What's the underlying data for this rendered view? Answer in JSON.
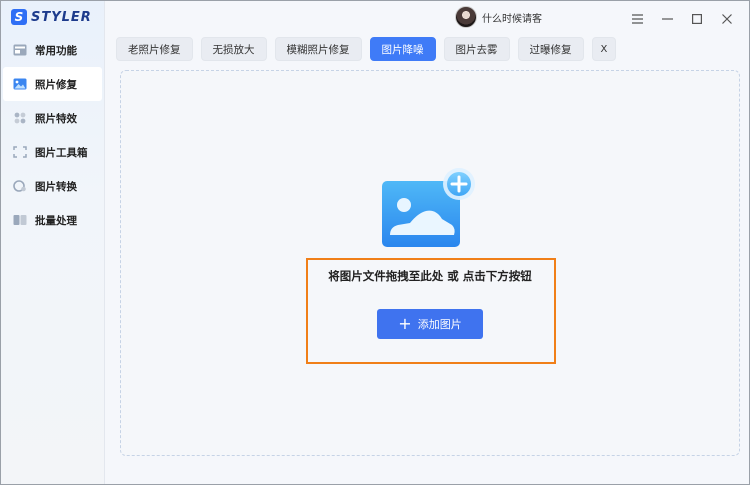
{
  "app": {
    "logo_letter": "S",
    "logo_text": "STYLER"
  },
  "user": {
    "name": "什么时候请客"
  },
  "window_controls": [
    {
      "name": "menu-icon",
      "glyph": "☰"
    },
    {
      "name": "minimize-icon",
      "glyph": "—"
    },
    {
      "name": "maximize-icon",
      "glyph": "☐"
    },
    {
      "name": "close-icon",
      "glyph": "✕"
    }
  ],
  "sidebar": {
    "items": [
      {
        "label": "常用功能",
        "icon": "grid-icon",
        "active": false
      },
      {
        "label": "照片修复",
        "icon": "image-icon",
        "active": true
      },
      {
        "label": "照片特效",
        "icon": "puzzle-icon",
        "active": false
      },
      {
        "label": "图片工具箱",
        "icon": "crop-icon",
        "active": false
      },
      {
        "label": "图片转换",
        "icon": "convert-icon",
        "active": false
      },
      {
        "label": "批量处理",
        "icon": "stack-icon",
        "active": false
      }
    ]
  },
  "tabs": [
    {
      "label": "老照片修复",
      "active": false
    },
    {
      "label": "无损放大",
      "active": false
    },
    {
      "label": "模糊照片修复",
      "active": false
    },
    {
      "label": "图片降噪",
      "active": true
    },
    {
      "label": "图片去雾",
      "active": false
    },
    {
      "label": "过曝修复",
      "active": false
    }
  ],
  "tab_close": "X",
  "dropzone": {
    "instruction": "将图片文件拖拽至此处 或 点击下方按钮",
    "add_button": "添加图片",
    "add_icon": "+"
  },
  "colors": {
    "accent": "#3f7bf7",
    "highlight_border": "#f07f18"
  }
}
